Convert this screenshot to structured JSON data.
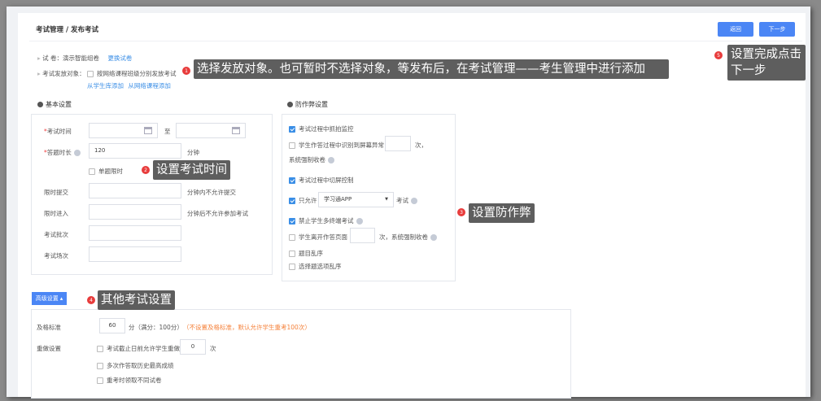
{
  "header": {
    "breadcrumb": "考试管理 / 发布考试",
    "back_label": "返回",
    "next_label": "下一步"
  },
  "paper": {
    "label": "试 卷：",
    "value": "演示智能组卷",
    "change_link": "更换试卷"
  },
  "target": {
    "label": "考试发放对象：",
    "checkbox_label": "按网络课程班级分别发放考试",
    "link_students": "从学生库添加",
    "link_courses": "从网络课程添加"
  },
  "basic": {
    "title": "基本设置",
    "exam_time_label": "考试时间",
    "to_label": "至",
    "duration_label": "答题时长",
    "duration_value": "120",
    "minutes": "分钟",
    "single_limit": "单题限时",
    "submit_limit_label": "限时提交",
    "submit_limit_suffix": "分钟内不允许提交",
    "enter_limit_label": "限时进入",
    "enter_limit_suffix": "分钟后不允许参加考试",
    "batch_label": "考试批次",
    "session_label": "考试场次"
  },
  "anticheat": {
    "title": "防作弊设置",
    "snapshot": "考试过程中抓拍监控",
    "screen_abnormal": "学生作答过程中识别到屏幕异常",
    "times_comma": "次，",
    "force_submit": "系统强制收卷",
    "switch_screen": "考试过程中切屏控制",
    "only_allow": "只允许",
    "app_option": "学习通APP",
    "exam": "考试",
    "multi_device": "禁止学生多终端考试",
    "leave_page": "学生离开作答页面",
    "leave_suffix": "次，系统强制收卷",
    "shuffle_questions": "题目乱序",
    "shuffle_options": "选择题选项乱序"
  },
  "advanced": {
    "toggle_label": "高级设置",
    "pass_label": "及格标准",
    "pass_value": "60",
    "pass_suffix": "分（满分：100分）",
    "pass_note": "（不设置及格标准，默认允许学生重考100次）",
    "redo_label": "重做设置",
    "redo_allow": "考试截止日前允许学生重做",
    "redo_value": "0",
    "redo_unit": "次",
    "redo_highest": "多次作答取历史最高成绩",
    "redo_diff": "重考时领取不同试卷"
  },
  "callouts": [
    {
      "num": "1",
      "text": "选择发放对象。也可暂时不选择对象，等发布后，在考试管理——考生管理中进行添加"
    },
    {
      "num": "2",
      "text": "设置考试时间"
    },
    {
      "num": "3",
      "text": "设置防作弊"
    },
    {
      "num": "4",
      "text": "其他考试设置"
    },
    {
      "num": "5",
      "text": "设置完成点击下一步"
    }
  ],
  "colors": {
    "primary": "#4b86f5",
    "note": "#f5813a",
    "callout": "#5e5e5e",
    "badge": "#e83c3c"
  }
}
